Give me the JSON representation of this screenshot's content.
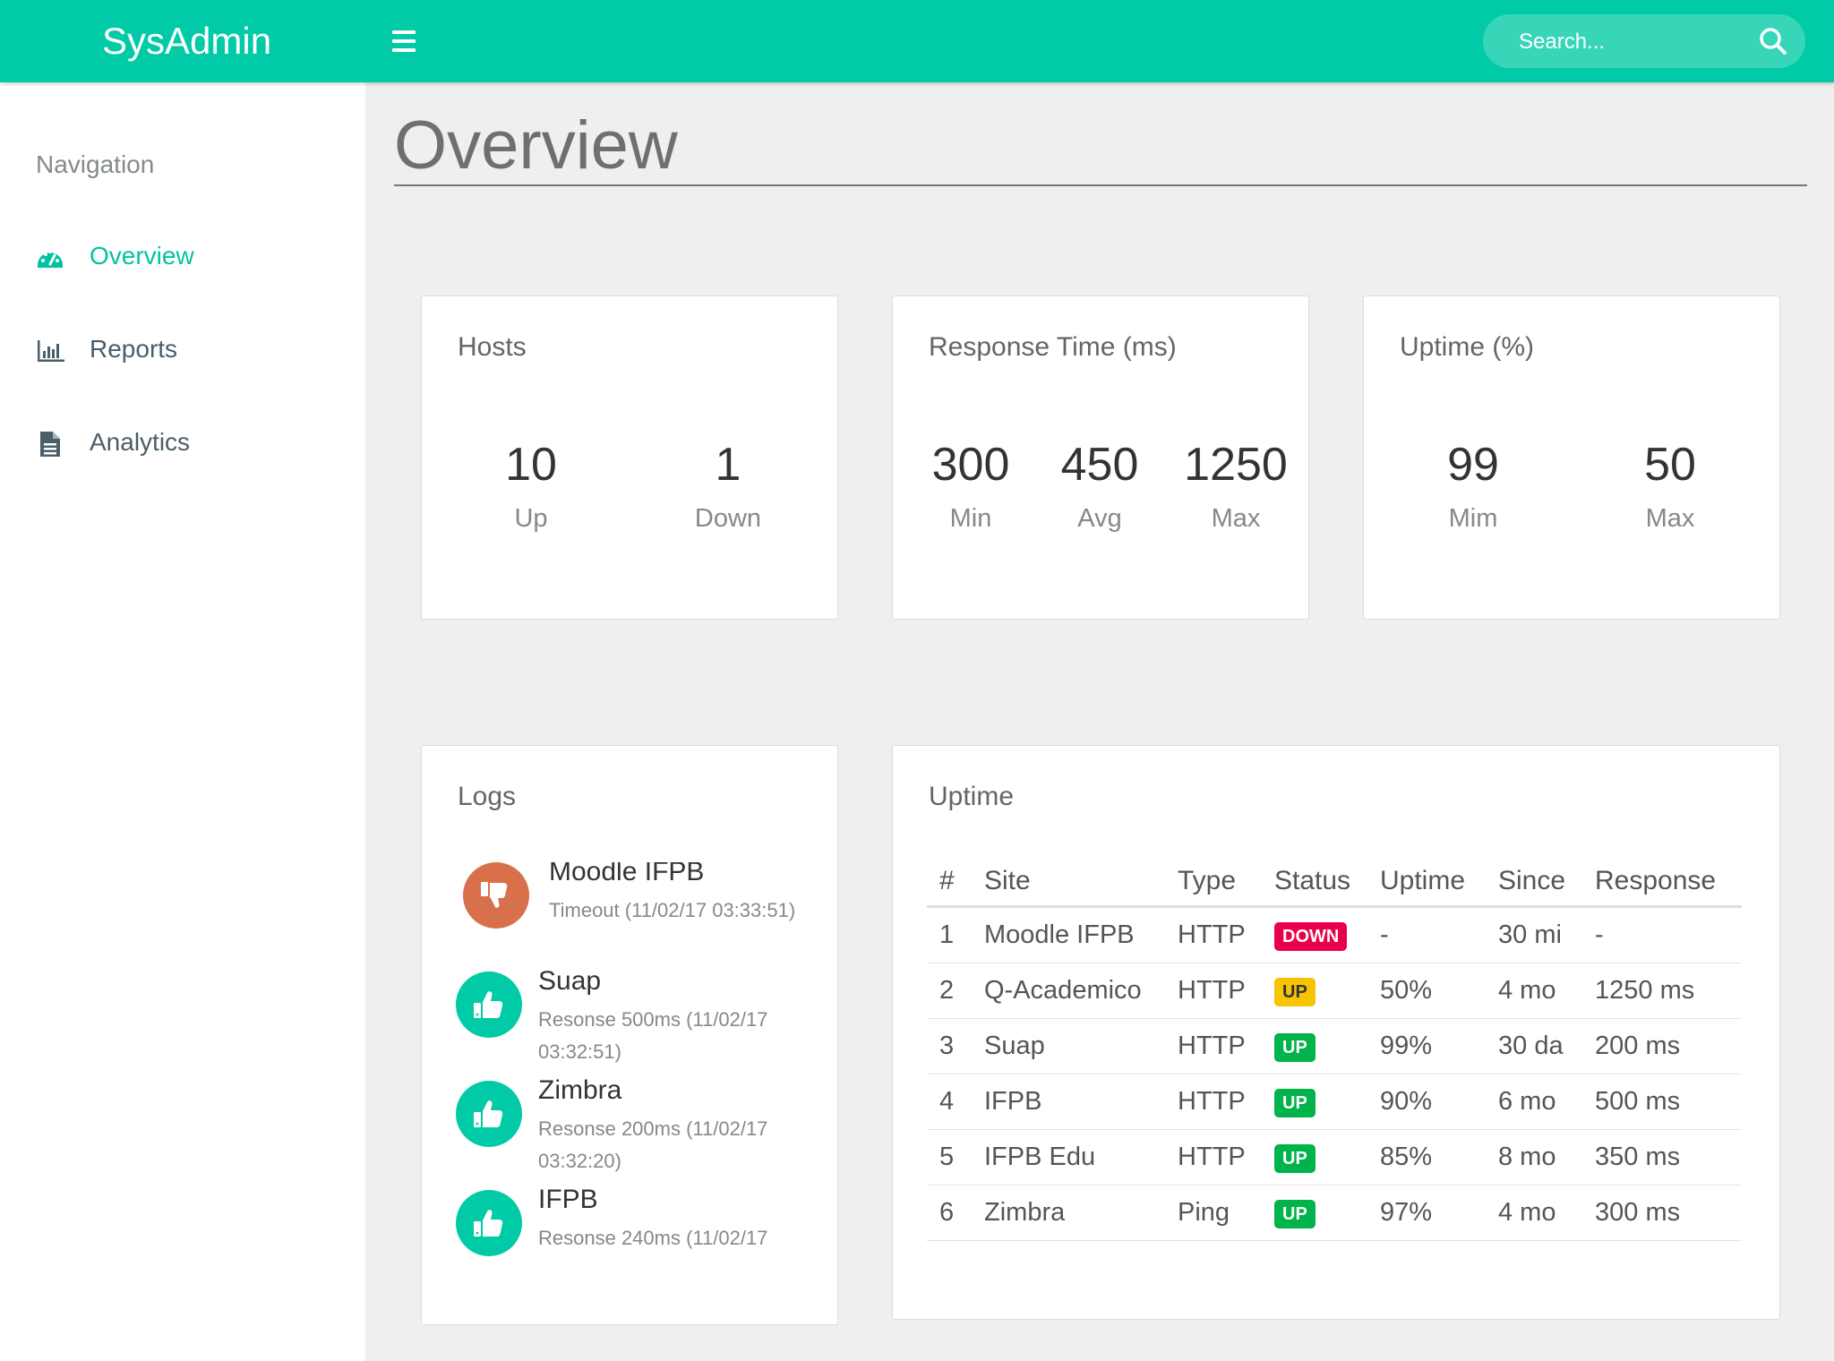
{
  "header": {
    "brand": "SysAdmin",
    "menu_icon": "hamburger-menu-icon",
    "search_placeholder": "Search...",
    "search_icon": "search-icon",
    "accent_color": "#00cba6"
  },
  "sidebar": {
    "heading": "Navigation",
    "items": [
      {
        "label": "Overview",
        "icon": "dashboard-gauge-icon",
        "active": true
      },
      {
        "label": "Reports",
        "icon": "bar-chart-icon",
        "active": false
      },
      {
        "label": "Analytics",
        "icon": "document-icon",
        "active": false
      }
    ]
  },
  "main": {
    "title": "Overview",
    "cards": {
      "hosts": {
        "title": "Hosts",
        "stats": [
          {
            "value": "10",
            "label": "Up"
          },
          {
            "value": "1",
            "label": "Down"
          }
        ]
      },
      "response": {
        "title": "Response Time (ms)",
        "stats": [
          {
            "value": "300",
            "label": "Min"
          },
          {
            "value": "450",
            "label": "Avg"
          },
          {
            "value": "1250",
            "label": "Max"
          }
        ]
      },
      "uptime": {
        "title": "Uptime (%)",
        "stats": [
          {
            "value": "99",
            "label": "Mim"
          },
          {
            "value": "50",
            "label": "Max"
          }
        ]
      }
    },
    "logs": {
      "title": "Logs",
      "items": [
        {
          "name": "Moodle IFPB",
          "desc": "Timeout (11/02/17 03:33:51)",
          "status": "down",
          "icon": "thumbs-down-icon"
        },
        {
          "name": "Suap",
          "desc": "Resonse 500ms (11/02/17 03:32:51)",
          "status": "up",
          "icon": "thumbs-up-icon"
        },
        {
          "name": "Zimbra",
          "desc": "Resonse 200ms (11/02/17 03:32:20)",
          "status": "up",
          "icon": "thumbs-up-icon"
        },
        {
          "name": "IFPB",
          "desc": "Resonse 240ms (11/02/17",
          "status": "up",
          "icon": "thumbs-up-icon"
        }
      ]
    },
    "uptime_table": {
      "title": "Uptime",
      "columns": [
        "#",
        "Site",
        "Type",
        "Status",
        "Uptime",
        "Since",
        "Response"
      ],
      "rows": [
        [
          "1",
          "Moodle IFPB",
          "HTTP",
          "DOWN",
          "-",
          "30 mi",
          "-"
        ],
        [
          "2",
          "Q-Academico",
          "HTTP",
          "UP",
          "50%",
          "4 mo",
          "1250 ms"
        ],
        [
          "3",
          "Suap",
          "HTTP",
          "UP",
          "99%",
          "30 da",
          "200 ms"
        ],
        [
          "4",
          "IFPB",
          "HTTP",
          "UP",
          "90%",
          "6 mo",
          "500 ms"
        ],
        [
          "5",
          "IFPB Edu",
          "HTTP",
          "UP",
          "85%",
          "8 mo",
          "350 ms"
        ],
        [
          "6",
          "Zimbra",
          "Ping",
          "UP",
          "97%",
          "4 mo",
          "300 ms"
        ]
      ],
      "status_colors": {
        "DOWN": "#e8004a",
        "UP_warn": "#f8c300",
        "UP": "#00b34a"
      },
      "row_status_variant": [
        "DOWN",
        "UP_warn",
        "UP",
        "UP",
        "UP",
        "UP"
      ]
    }
  },
  "colors": {
    "down_avatar": "#d9704c",
    "up_avatar": "#00cba6",
    "active_nav": "#00c49f"
  }
}
